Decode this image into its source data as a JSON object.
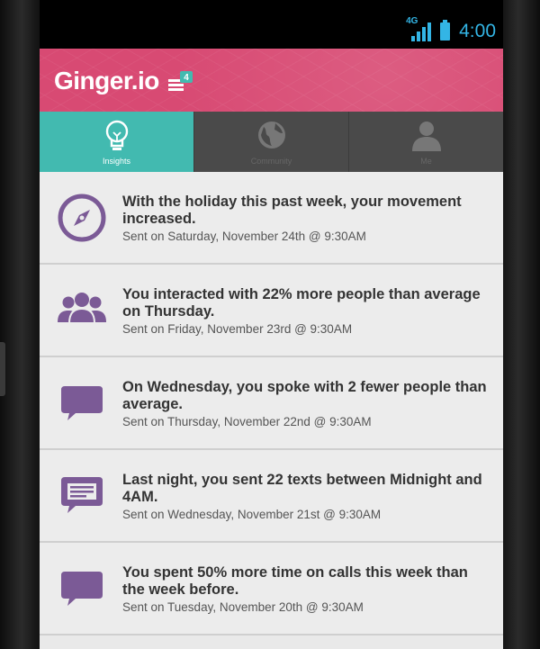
{
  "status_bar": {
    "network": "4G",
    "time": "4:00"
  },
  "header": {
    "brand": "Ginger.io",
    "menu_badge": "4"
  },
  "tabs": [
    {
      "label": "Insights",
      "icon": "lightbulb-icon",
      "active": true
    },
    {
      "label": "Community",
      "icon": "globe-icon",
      "active": false
    },
    {
      "label": "Me",
      "icon": "person-icon",
      "active": false
    }
  ],
  "feed": [
    {
      "icon": "compass-icon",
      "message": "With the holiday this past week, your movement increased.",
      "sent": "Sent on Saturday, November 24th @ 9:30AM"
    },
    {
      "icon": "people-icon",
      "message": "You interacted with 22% more people than average on Thursday.",
      "sent": "Sent on Friday, November 23rd @ 9:30AM"
    },
    {
      "icon": "speech-bubbles-icon",
      "message": "On Wednesday, you spoke with 2 fewer people than average.",
      "sent": "Sent on Thursday, November 22nd @ 9:30AM"
    },
    {
      "icon": "text-message-icon",
      "message": "Last night, you sent 22 texts between Midnight and 4AM.",
      "sent": "Sent on Wednesday, November 21st @ 9:30AM"
    },
    {
      "icon": "speech-bubbles-icon",
      "message": "You spent 50% more time on calls this week than the week before.",
      "sent": "Sent on Tuesday, November 20th @ 9:30AM"
    }
  ],
  "colors": {
    "accent_pink": "#d84a73",
    "accent_teal": "#42bab0",
    "icon_purple": "#7b5a96",
    "status_blue": "#33b5e5"
  }
}
